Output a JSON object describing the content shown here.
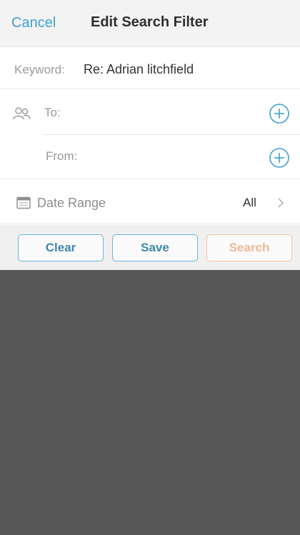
{
  "header": {
    "cancel_label": "Cancel",
    "title": "Edit Search Filter"
  },
  "keyword": {
    "label": "Keyword:",
    "value": "Re: Adrian litchfield"
  },
  "recipients": {
    "to_label": "To:",
    "from_label": "From:",
    "people_icon": "people-icon",
    "add_icon": "plus-circle-icon"
  },
  "date_range": {
    "label": "Date Range",
    "value": "All",
    "calendar_icon": "calendar-icon",
    "chevron_icon": "chevron-right-icon"
  },
  "actions": {
    "clear_label": "Clear",
    "save_label": "Save",
    "search_label": "Search"
  },
  "colors": {
    "accent": "#3fa0cf",
    "search_disabled": "#f0b894",
    "overlay": "#575757"
  }
}
